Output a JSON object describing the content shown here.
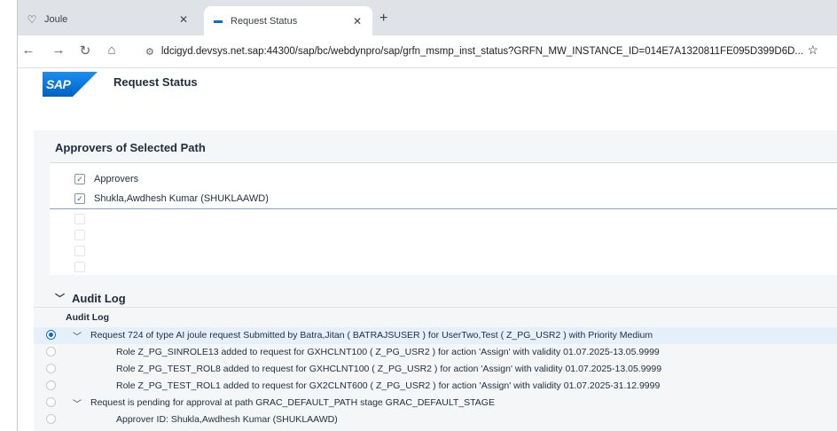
{
  "browser": {
    "tabs": [
      {
        "title": "Joule",
        "icon": "joule-icon"
      },
      {
        "title": "Request Status",
        "icon": "sap-tab-icon"
      }
    ],
    "url": "ldcigyd.devsys.net.sap:44300/sap/bc/webdynpro/sap/grfn_msmp_inst_status?GRFN_MW_INSTANCE_ID=014E7A1320811FE095D399D6D..."
  },
  "sap": {
    "logo_text": "SAP",
    "page_title": "Request Status"
  },
  "approvers_section": {
    "title": "Approvers of Selected Path",
    "header_label": "Approvers",
    "rows": [
      "Shukla,Awdhesh Kumar (SHUKLAAWD)"
    ]
  },
  "audit_log": {
    "title": "Audit Log",
    "column_header": "Audit Log",
    "rows": [
      {
        "text": "Request 724 of type AI joule request Submitted by Batra,Jitan ( BATRAJSUSER ) for UserTwo,Test ( Z_PG_USR2 ) with Priority Medium",
        "selected": true,
        "expandable": true
      },
      {
        "text": "Role Z_PG_SINROLE13 added to request for GXHCLNT100 ( Z_PG_USR2 ) for action 'Assign' with validity 01.07.2025-13.05.9999",
        "selected": false,
        "expandable": false
      },
      {
        "text": "Role Z_PG_TEST_ROL8 added to request for GXHCLNT100 ( Z_PG_USR2 ) for action 'Assign' with validity 01.07.2025-13.05.9999",
        "selected": false,
        "expandable": false
      },
      {
        "text": "Role Z_PG_TEST_ROL1 added to request for GX2CLNT600 ( Z_PG_USR2 ) for action 'Assign' with validity 01.07.2025-31.12.9999",
        "selected": false,
        "expandable": false
      },
      {
        "text": "Request is pending for approval at path GRAC_DEFAULT_PATH stage GRAC_DEFAULT_STAGE",
        "selected": false,
        "expandable": true
      },
      {
        "text": "Approver ID: Shukla,Awdhesh Kumar (SHUKLAAWD)",
        "selected": false,
        "expandable": false
      }
    ]
  },
  "colors": {
    "sap_blue": "#0a6ed1",
    "tabbar_bg": "#dfe3e8",
    "content_bg": "#f5f6f7",
    "selected_row_bg": "#e5f0fa"
  }
}
